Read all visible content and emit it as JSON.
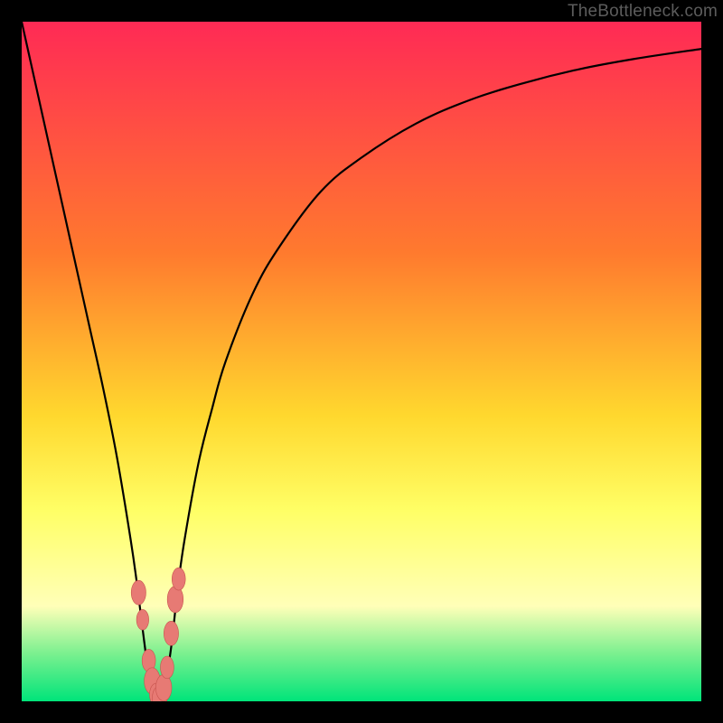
{
  "watermark": "TheBottleneck.com",
  "colors": {
    "frame": "#000000",
    "grad_top": "#ff2a55",
    "grad_mid1": "#ff7a2e",
    "grad_mid2": "#ffd82e",
    "grad_yellow": "#ffff66",
    "grad_pale": "#ffffb8",
    "grad_green1": "#7af08f",
    "grad_green2": "#00e47a",
    "curve": "#000000",
    "marker_fill": "#e77a74",
    "marker_stroke": "#c7544e"
  },
  "chart_data": {
    "type": "line",
    "title": "",
    "xlabel": "",
    "ylabel": "",
    "xlim": [
      0,
      100
    ],
    "ylim": [
      0,
      100
    ],
    "series": [
      {
        "name": "bottleneck-curve",
        "x": [
          0,
          2,
          4,
          6,
          8,
          10,
          12,
          14,
          16,
          17,
          18,
          19,
          20,
          21,
          22,
          23,
          24,
          26,
          28,
          30,
          34,
          38,
          44,
          50,
          58,
          66,
          74,
          82,
          90,
          100
        ],
        "y": [
          100,
          91,
          82,
          73,
          64,
          55,
          46,
          36,
          24,
          17,
          9,
          2,
          0,
          2,
          8,
          17,
          24,
          35,
          43,
          50,
          60,
          67,
          75,
          80,
          85,
          88.5,
          91,
          93,
          94.5,
          96
        ]
      }
    ],
    "markers": [
      {
        "x": 17.2,
        "y": 16,
        "r": 1.2
      },
      {
        "x": 17.8,
        "y": 12,
        "r": 1.0
      },
      {
        "x": 18.7,
        "y": 6,
        "r": 1.1
      },
      {
        "x": 19.2,
        "y": 3,
        "r": 1.3
      },
      {
        "x": 19.8,
        "y": 1,
        "r": 1.1
      },
      {
        "x": 20.3,
        "y": 0.5,
        "r": 1.2
      },
      {
        "x": 20.9,
        "y": 2,
        "r": 1.3
      },
      {
        "x": 21.4,
        "y": 5,
        "r": 1.1
      },
      {
        "x": 22.0,
        "y": 10,
        "r": 1.2
      },
      {
        "x": 22.6,
        "y": 15,
        "r": 1.3
      },
      {
        "x": 23.1,
        "y": 18,
        "r": 1.1
      }
    ],
    "gradient_stops": [
      {
        "offset": 0.0,
        "color_key": "grad_top"
      },
      {
        "offset": 0.34,
        "color_key": "grad_mid1"
      },
      {
        "offset": 0.58,
        "color_key": "grad_mid2"
      },
      {
        "offset": 0.72,
        "color_key": "grad_yellow"
      },
      {
        "offset": 0.86,
        "color_key": "grad_pale"
      },
      {
        "offset": 0.93,
        "color_key": "grad_green1"
      },
      {
        "offset": 1.0,
        "color_key": "grad_green2"
      }
    ]
  }
}
